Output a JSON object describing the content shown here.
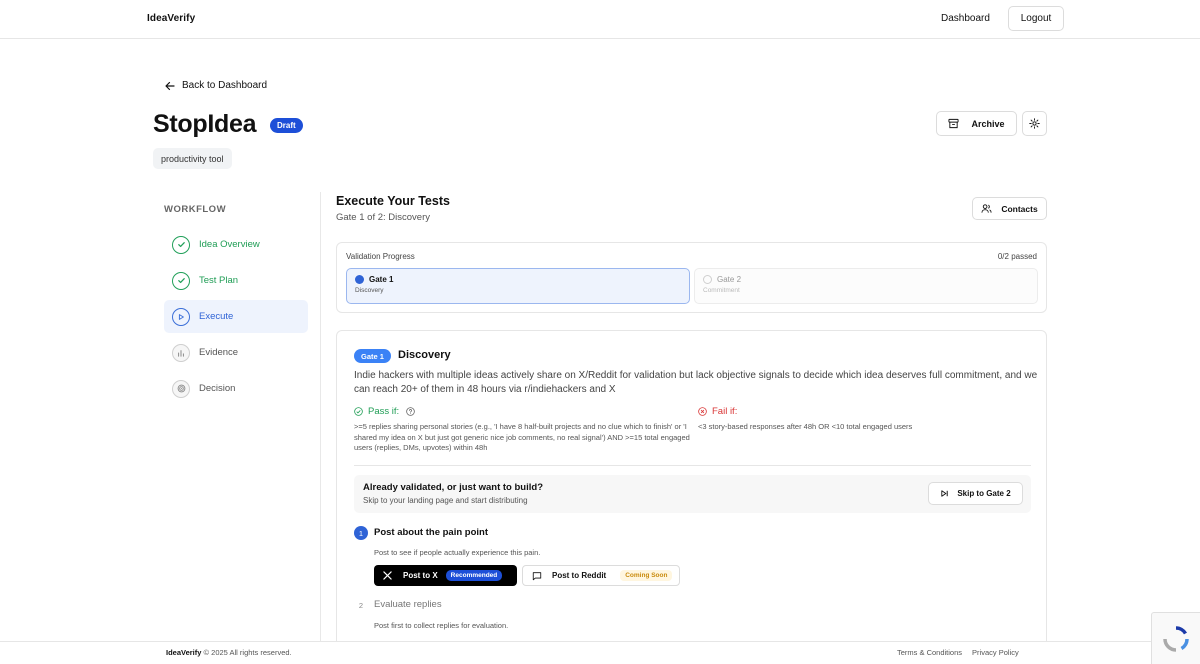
{
  "header": {
    "brand": "IdeaVerify",
    "dashboard_link": "Dashboard",
    "logout_label": "Logout"
  },
  "back_link": "Back to Dashboard",
  "idea": {
    "title": "StopIdea",
    "status_badge": "Draft",
    "tag": "productivity tool",
    "archive_label": "Archive"
  },
  "workflow": {
    "label": "WORKFLOW",
    "items": [
      {
        "label": "Idea Overview",
        "state": "done"
      },
      {
        "label": "Test Plan",
        "state": "done"
      },
      {
        "label": "Execute",
        "state": "active"
      },
      {
        "label": "Evidence",
        "state": "pending"
      },
      {
        "label": "Decision",
        "state": "pending"
      }
    ]
  },
  "execute": {
    "title": "Execute Your Tests",
    "subtitle": "Gate 1 of 2: Discovery",
    "contacts_label": "Contacts",
    "progress": {
      "label": "Validation Progress",
      "count": "0/2 passed",
      "gates": [
        {
          "name": "Gate 1",
          "desc": "Discovery",
          "active": true
        },
        {
          "name": "Gate 2",
          "desc": "Commitment",
          "active": false
        }
      ]
    },
    "gate_card": {
      "pill": "Gate 1",
      "title": "Discovery",
      "hypothesis": "Indie hackers with multiple ideas actively share on X/Reddit for validation but lack objective signals to decide which idea deserves full commitment, and we can reach 20+ of them in 48 hours via r/indiehackers and X",
      "pass_label": "Pass if:",
      "pass_text": ">=5 replies sharing personal stories (e.g., 'I have 8 half-built projects and no clue which to finish' or 'I shared my idea on X but just got generic nice job comments, no real signal') AND >=15 total engaged users (replies, DMs, upvotes) within 48h",
      "fail_label": "Fail if:",
      "fail_text": "<3 story-based responses after 48h OR <10 total engaged users",
      "already_title": "Already validated, or just want to build?",
      "already_sub": "Skip to your landing page and start distributing",
      "skip_label": "Skip to Gate 2",
      "steps": [
        {
          "num": "1",
          "title": "Post about the pain point",
          "sub": "Post to see if people actually experience this pain."
        },
        {
          "num": "2",
          "title": "Evaluate replies",
          "sub": "Post first to collect replies for evaluation."
        }
      ],
      "post_x_label": "Post to X",
      "post_x_badge": "Recommended",
      "post_reddit_label": "Post to Reddit",
      "post_reddit_badge": "Coming Soon"
    }
  },
  "footer": {
    "brand": "IdeaVerify",
    "copyright": "© 2025 All rights reserved.",
    "terms": "Terms & Conditions",
    "privacy": "Privacy Policy"
  },
  "colors": {
    "accent": "#2f63d6",
    "success": "#1f9d55",
    "danger": "#d93636",
    "badge_blue": "#1d4fd8"
  }
}
